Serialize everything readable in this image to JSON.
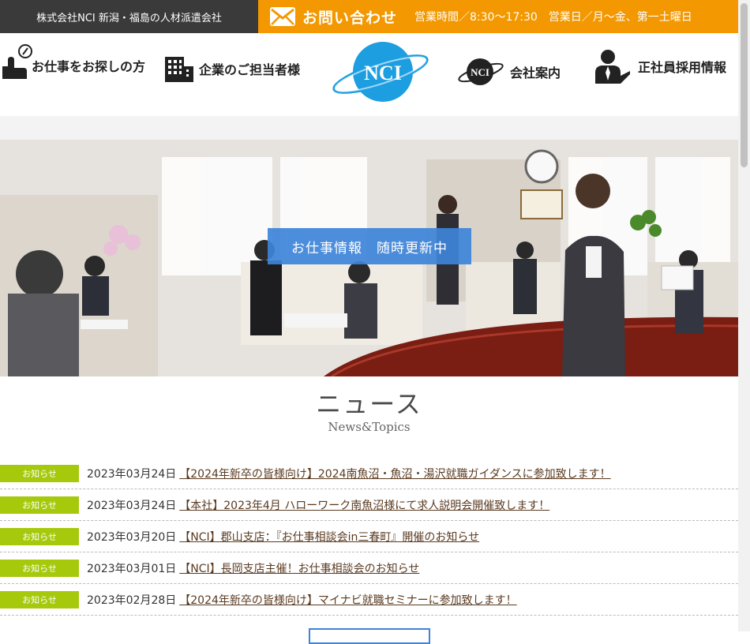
{
  "topbar": {
    "company": "株式会社NCI 新潟・福島の人材派遣会社",
    "contact_label": "お問い合わせ",
    "hours": "営業時間／8:30〜17:30　営業日／月〜金、第一土曜日"
  },
  "nav": {
    "job_seekers": "お仕事をお探しの方",
    "companies": "企業のご担当者様",
    "logo_text": "NCI",
    "about": "会社案内",
    "recruit": "正社員採用情報"
  },
  "hero": {
    "caption": "お仕事情報　随時更新中"
  },
  "news": {
    "title": "ニュース",
    "subtitle": "News&Topics",
    "items": [
      {
        "badge": "お知らせ",
        "date": "2023年03月24日",
        "title": "【2024年新卒の皆様向け】2024南魚沼・魚沼・湯沢就職ガイダンスに参加致します！"
      },
      {
        "badge": "お知らせ",
        "date": "2023年03月24日",
        "title": "【本社】2023年4月 ハローワーク南魚沼様にて求人説明会開催致します！"
      },
      {
        "badge": "お知らせ",
        "date": "2023年03月20日",
        "title": "【NCI】郡山支店：『お仕事相談会in三春町』開催のお知らせ"
      },
      {
        "badge": "お知らせ",
        "date": "2023年03月01日",
        "title": "【NCI】長岡支店主催！お仕事相談会のお知らせ"
      },
      {
        "badge": "お知らせ",
        "date": "2023年02月28日",
        "title": "【2024年新卒の皆様向け】マイナビ就職セミナーに参加致します！"
      }
    ]
  },
  "colors": {
    "topbar_dark": "#3a3a3a",
    "accent_orange": "#f39800",
    "badge_green": "#a6c90c",
    "caption_blue": "#3e84d9",
    "logo_blue": "#1d9ee0"
  }
}
